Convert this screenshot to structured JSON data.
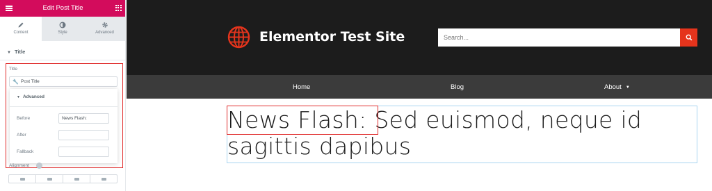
{
  "panel": {
    "header_title": "Edit Post Title",
    "tabs": [
      {
        "label": "Content",
        "icon": "pencil-icon",
        "active": true
      },
      {
        "label": "Style",
        "icon": "half-circle-icon",
        "active": false
      },
      {
        "label": "Advanced",
        "icon": "gear-icon",
        "active": false
      }
    ],
    "section_title": "Title",
    "title_label": "Title",
    "title_value": "Post Title",
    "advanced": {
      "title": "Advanced",
      "before_label": "Before",
      "before_value": "News Flash:",
      "after_label": "After",
      "after_value": "",
      "fallback_label": "Fallback",
      "fallback_value": ""
    },
    "alignment_label": "Alignment",
    "accent_color": "#d30c5c"
  },
  "site": {
    "title": "Elementor Test Site",
    "search_placeholder": "Search...",
    "nav": [
      {
        "label": "Home"
      },
      {
        "label": "Blog"
      },
      {
        "label": "About"
      }
    ],
    "post_prefix": "News Flash:",
    "post_title": " Sed euismod, neque id sagittis dapibus",
    "search_button_color": "#e5341c",
    "header_color": "#1c1c1c",
    "nav_color": "#3b3b3b",
    "highlight_color": "#e02b2b"
  }
}
